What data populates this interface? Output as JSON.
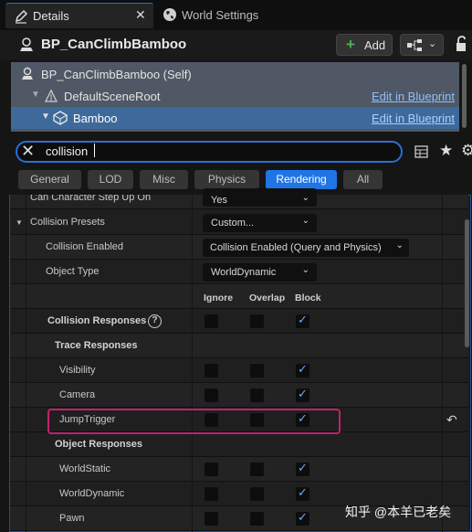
{
  "tabs": {
    "details": "Details",
    "world_settings": "World Settings"
  },
  "header": {
    "title": "BP_CanClimbBamboo",
    "add_label": "Add"
  },
  "tree": {
    "self": "BP_CanClimbBamboo (Self)",
    "root": "DefaultSceneRoot",
    "bamboo": "Bamboo",
    "edit_link": "Edit in Blueprint"
  },
  "search": {
    "value": "collision"
  },
  "filters": [
    "General",
    "LOD",
    "Misc",
    "Physics",
    "Rendering",
    "All"
  ],
  "filters_active": "Rendering",
  "props": {
    "step_up_label": "Can Character Step Up On",
    "step_up_value": "Yes",
    "presets_label": "Collision Presets",
    "presets_value": "Custom...",
    "enabled_label": "Collision Enabled",
    "enabled_value": "Collision Enabled (Query and Physics)",
    "object_type_label": "Object Type",
    "object_type_value": "WorldDynamic",
    "col_ignore": "Ignore",
    "col_overlap": "Overlap",
    "col_block": "Block",
    "responses_label": "Collision Responses",
    "trace_label": "Trace Responses",
    "object_resp_label": "Object Responses"
  },
  "responses": [
    {
      "name": "Visibility",
      "ignore": false,
      "overlap": false,
      "block": true
    },
    {
      "name": "Camera",
      "ignore": false,
      "overlap": false,
      "block": true
    },
    {
      "name": "JumpTrigger",
      "ignore": false,
      "overlap": false,
      "block": true
    },
    {
      "name": "WorldStatic",
      "ignore": false,
      "overlap": false,
      "block": true
    },
    {
      "name": "WorldDynamic",
      "ignore": false,
      "overlap": false,
      "block": true
    },
    {
      "name": "Pawn",
      "ignore": false,
      "overlap": false,
      "block": true
    }
  ],
  "watermark": "知乎 @本羊已老矣",
  "colors": {
    "accent": "#1f74e6",
    "highlight": "#c4206e",
    "check": "#6aa9ff"
  }
}
